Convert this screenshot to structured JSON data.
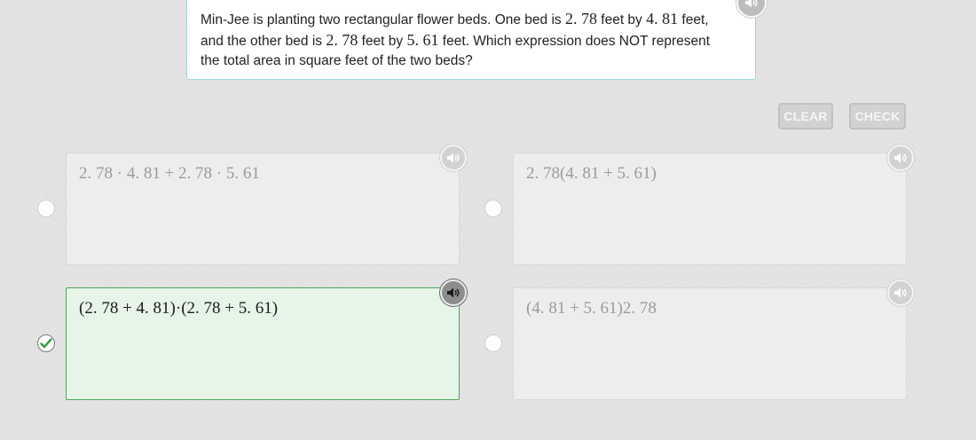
{
  "question": {
    "lines": [
      [
        "Min-Jee is planting two rectangular flower beds. One bed is ",
        "2. 78",
        " feet by ",
        "4. 81",
        " feet,"
      ],
      [
        "and the other bed is ",
        "2. 78",
        " feet by ",
        "5. 61",
        " feet. Which expression does NOT represent"
      ],
      [
        "the total area in square feet of the two beds?"
      ]
    ]
  },
  "buttons": {
    "clear": "CLEAR",
    "check": "CHECK"
  },
  "choices": [
    {
      "expression": "2. 78 · 4. 81 + 2. 78 · 5. 61",
      "selected": false
    },
    {
      "expression": "2. 78(4. 81 + 5. 61)",
      "selected": false
    },
    {
      "expression": "(2. 78 + 4. 81)·(2. 78 + 5. 61)",
      "selected": true
    },
    {
      "expression": "(4. 81 + 5. 61)2. 78",
      "selected": false
    }
  ],
  "icons": {
    "audio": "speaker-icon",
    "selected_radio": "checkmark-icon"
  },
  "colors": {
    "selected_border": "#4aa853",
    "selected_bg": "#e7f5e9",
    "question_border": "#9fd7dd"
  }
}
